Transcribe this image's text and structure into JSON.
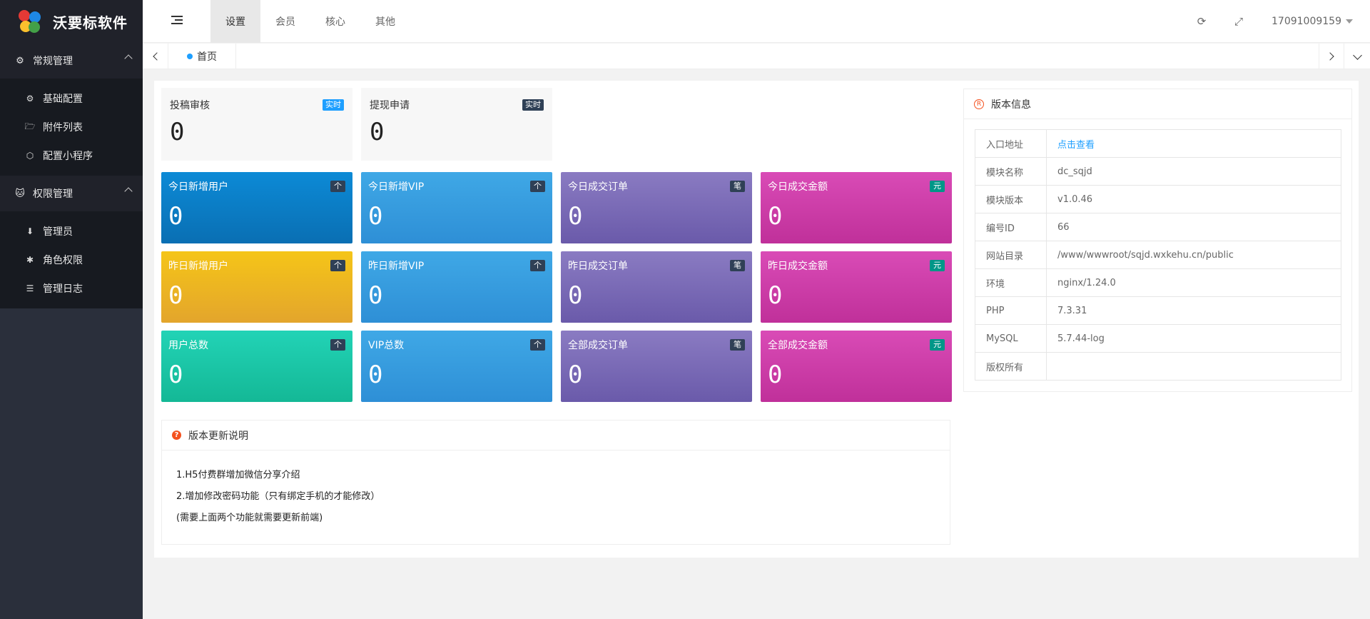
{
  "brand": {
    "title": "沃要标软件"
  },
  "sidebar": {
    "groups": [
      {
        "label": "常规管理",
        "icon": "gear-icon",
        "items": [
          {
            "label": "基础配置",
            "icon": "gear-icon"
          },
          {
            "label": "附件列表",
            "icon": "folder-icon"
          },
          {
            "label": "配置小程序",
            "icon": "cube-icon"
          }
        ]
      },
      {
        "label": "权限管理",
        "icon": "cat-icon",
        "items": [
          {
            "label": "管理员",
            "icon": "download-circle-icon"
          },
          {
            "label": "角色权限",
            "icon": "bug-icon"
          },
          {
            "label": "管理日志",
            "icon": "list-icon"
          }
        ]
      }
    ]
  },
  "header": {
    "tabs": [
      "设置",
      "会员",
      "核心",
      "其他"
    ],
    "active_tab": "设置",
    "user": "17091009159"
  },
  "tabbar": {
    "home": "首页"
  },
  "summary_cards": [
    {
      "label": "投稿审核",
      "badge": "实时",
      "badge_color": "#1e9fff",
      "value": "0"
    },
    {
      "label": "提现申请",
      "badge": "实时",
      "badge_color": "#2f4056",
      "value": "0"
    }
  ],
  "tiles": [
    {
      "label": "今日新增用户",
      "badge": "个",
      "value": "0"
    },
    {
      "label": "今日新增VIP",
      "badge": "个",
      "value": "0"
    },
    {
      "label": "今日成交订单",
      "badge": "笔",
      "value": "0"
    },
    {
      "label": "今日成交金额",
      "badge": "元",
      "value": "0"
    },
    {
      "label": "昨日新增用户",
      "badge": "个",
      "value": "0"
    },
    {
      "label": "昨日新增VIP",
      "badge": "个",
      "value": "0"
    },
    {
      "label": "昨日成交订单",
      "badge": "笔",
      "value": "0"
    },
    {
      "label": "昨日成交金额",
      "badge": "元",
      "value": "0"
    },
    {
      "label": "用户总数",
      "badge": "个",
      "value": "0"
    },
    {
      "label": "VIP总数",
      "badge": "个",
      "value": "0"
    },
    {
      "label": "全部成交订单",
      "badge": "笔",
      "value": "0"
    },
    {
      "label": "全部成交金额",
      "badge": "元",
      "value": "0"
    }
  ],
  "tile_colors": {
    "blue_dark": [
      "#0c8ad6",
      "#0a6fb3"
    ],
    "blue": [
      "#3fa8e6",
      "#2e8fd6"
    ],
    "purple": [
      "#8a7bc2",
      "#6a5aaa"
    ],
    "magenta": [
      "#d94bb6",
      "#c0309a"
    ],
    "yellow": [
      "#f5c518",
      "#e3a52c"
    ],
    "teal": [
      "#22d3b6",
      "#14b896"
    ],
    "badge_green": "#009688",
    "badge_dark": "#2f4056"
  },
  "update_notes": {
    "title": "版本更新说明",
    "lines": [
      "1.H5付费群增加微信分享介绍",
      "2.增加修改密码功能（只有绑定手机的才能修改）",
      "(需要上面两个功能就需要更新前端)"
    ]
  },
  "version_info": {
    "title": "版本信息",
    "rows": [
      {
        "key": "入口地址",
        "value": "点击查看",
        "link": true
      },
      {
        "key": "模块名称",
        "value": "dc_sqjd"
      },
      {
        "key": "模块版本",
        "value": "v1.0.46"
      },
      {
        "key": "编号ID",
        "value": "66"
      },
      {
        "key": "网站目录",
        "value": "/www/wwwroot/sqjd.wxkehu.cn/public"
      },
      {
        "key": "环境",
        "value": "nginx/1.24.0"
      },
      {
        "key": "PHP",
        "value": "7.3.31"
      },
      {
        "key": "MySQL",
        "value": "5.7.44-log"
      },
      {
        "key": "版权所有",
        "value": ""
      }
    ]
  }
}
